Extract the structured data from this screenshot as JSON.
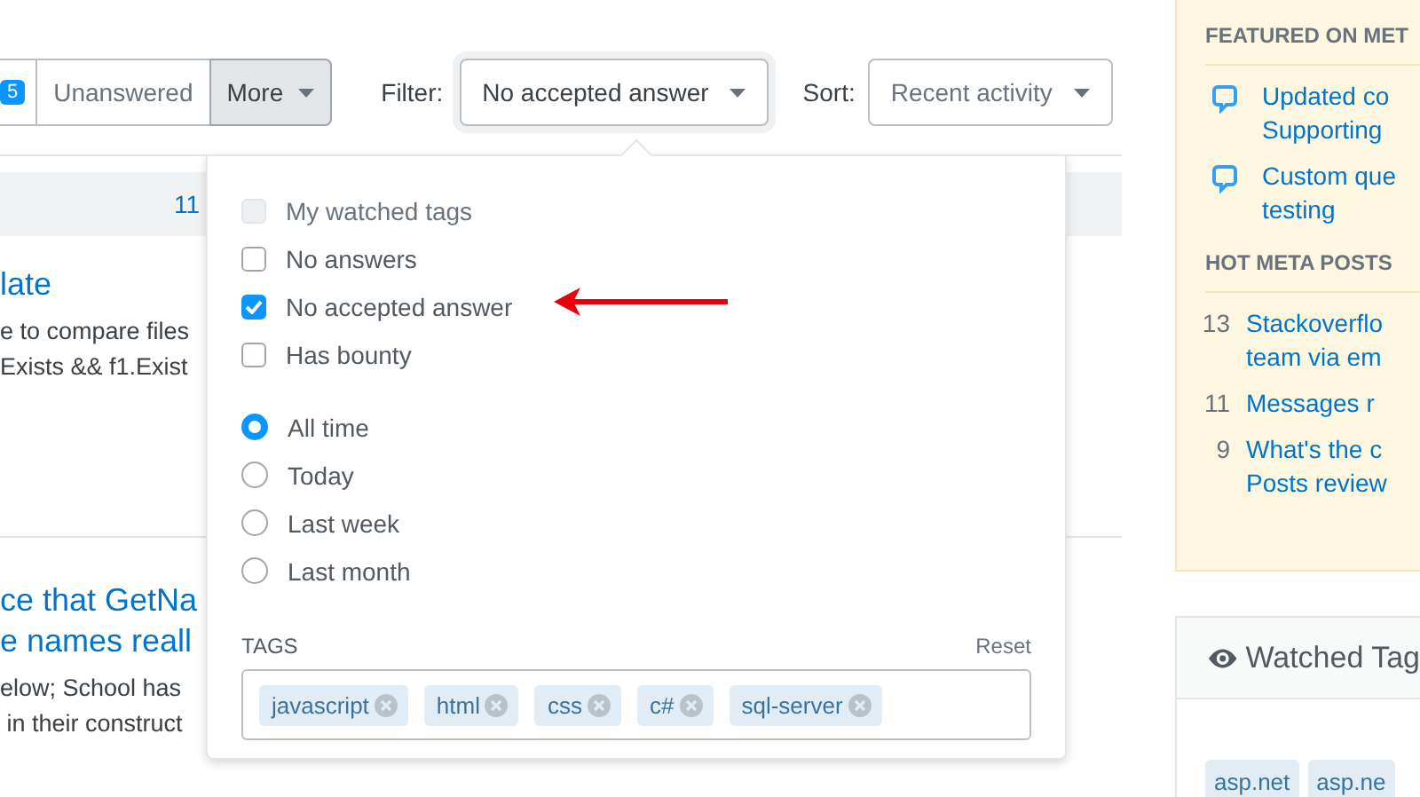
{
  "nav": {
    "badge": "5",
    "buttons": [
      {
        "label": "Unanswered",
        "selected": false,
        "kind": "tab"
      },
      {
        "label": "More",
        "selected": true,
        "kind": "menu"
      }
    ]
  },
  "filter": {
    "label": "Filter:",
    "value": "No accepted answer"
  },
  "sort": {
    "label": "Sort:",
    "value": "Recent activity"
  },
  "count_bar": {
    "text": "11"
  },
  "questions": [
    {
      "title": "late",
      "excerpt": "e to compare files\nExists && f1.Exist"
    },
    {
      "title": "ce that GetNa\ne names reall",
      "excerpt": "elow; School has\n in their construct"
    }
  ],
  "dropdown": {
    "checkboxes": [
      {
        "label": "My watched tags",
        "checked": false,
        "disabled": true
      },
      {
        "label": "No answers",
        "checked": false,
        "disabled": false
      },
      {
        "label": "No accepted answer",
        "checked": true,
        "disabled": false
      },
      {
        "label": "Has bounty",
        "checked": false,
        "disabled": false
      }
    ],
    "radios": [
      {
        "label": "All time",
        "selected": true
      },
      {
        "label": "Today",
        "selected": false
      },
      {
        "label": "Last week",
        "selected": false
      },
      {
        "label": "Last month",
        "selected": false
      }
    ],
    "tags_label": "TAGS",
    "reset": "Reset",
    "tags": [
      "javascript",
      "html",
      "css",
      "c#",
      "sql-server"
    ]
  },
  "sidebar": {
    "featured_heading": "FEATURED ON MET",
    "featured": [
      "Updated co\nSupporting",
      "Custom que\ntesting"
    ],
    "hot_heading": "HOT META POSTS",
    "hot": [
      {
        "score": "13",
        "title": "Stackoverflo\nteam via em"
      },
      {
        "score": "11",
        "title": "Messages r"
      },
      {
        "score": "9",
        "title": "What's the c\nPosts review"
      }
    ],
    "watched": {
      "title": "Watched Tag",
      "tags": [
        "asp.net",
        "asp.ne"
      ]
    }
  }
}
